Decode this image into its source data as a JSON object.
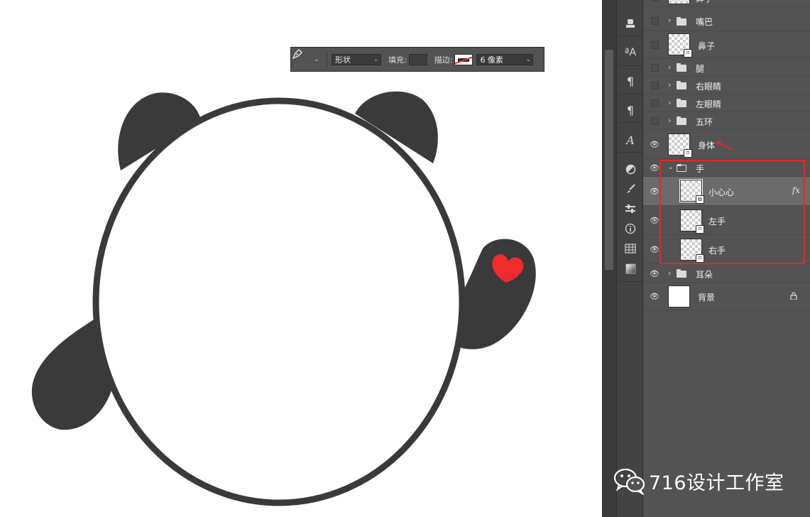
{
  "toolbar": {
    "tool_icon": "pen-icon",
    "mode_value": "形状",
    "fill_label": "填充:",
    "stroke_label": "描边:",
    "stroke_size_value": "6 像素",
    "stroke_color": "#e0322b"
  },
  "canvas": {
    "background": "#ffffff",
    "panda_color": "#3a3a3a",
    "heart_color": "#f02b2b"
  },
  "tools": [
    "stamp-icon",
    "character-style-icon",
    "paragraph-style-icon",
    "paragraph-icon",
    "glyphs-icon",
    "adjustments-icon",
    "brush-settings-icon",
    "properties-icon",
    "info-icon",
    "table-icon",
    "gradient-icon"
  ],
  "layers": [
    {
      "name": "鼻子",
      "type": "shape",
      "visible": false
    },
    {
      "name": "嘴巴",
      "type": "group",
      "visible": false
    },
    {
      "name": "鼻子",
      "type": "shape",
      "visible": false
    },
    {
      "name": "腿",
      "type": "group",
      "visible": false
    },
    {
      "name": "右眼睛",
      "type": "group",
      "visible": false
    },
    {
      "name": "左眼睛",
      "type": "group",
      "visible": false
    },
    {
      "name": "五环",
      "type": "group",
      "visible": false
    },
    {
      "name": "身体",
      "type": "shape",
      "visible": true
    },
    {
      "name": "手",
      "type": "group-open",
      "visible": true
    },
    {
      "name": "小心心",
      "type": "shape",
      "visible": true,
      "fx": "fx",
      "selected": true
    },
    {
      "name": "左手",
      "type": "shape",
      "visible": true
    },
    {
      "name": "右手",
      "type": "shape",
      "visible": true
    },
    {
      "name": "耳朵",
      "type": "group",
      "visible": true
    },
    {
      "name": "背景",
      "type": "background",
      "visible": true,
      "locked": true
    }
  ],
  "highlight_color": "#e02a2a",
  "watermark": {
    "text": "716设计工作室",
    "icon": "wechat-icon"
  }
}
